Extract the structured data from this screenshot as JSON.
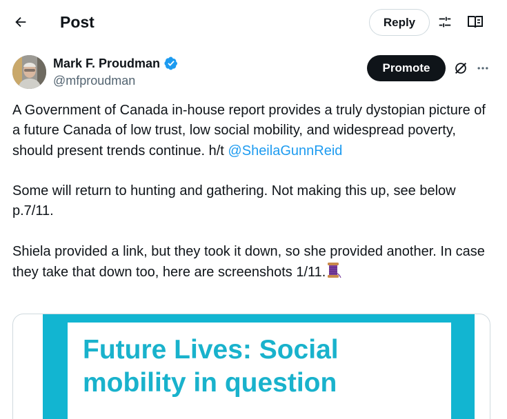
{
  "header": {
    "title": "Post",
    "reply_label": "Reply"
  },
  "author": {
    "name": "Mark F. Proudman",
    "handle": "@mfproudman",
    "promote_label": "Promote"
  },
  "post": {
    "paragraph1_text": "A Government of Canada in-house report provides a truly dystopian picture of a future Canada of low trust, low social mobility, and widespread poverty, should present trends continue.  h/t ",
    "paragraph1_mention": "@SheilaGunnReid",
    "paragraph2": "Some will return to hunting and gathering.  Not making this up, see below p.7/11.",
    "paragraph3": "Shiela provided a link, but they took it down, so she provided another.  In case they take that down too, here are screenshots 1/11."
  },
  "media": {
    "title_line1": "Future Lives: Social",
    "title_line2": "mobility in question"
  },
  "colors": {
    "accent": "#1d9bf0",
    "media_cyan": "#12b5d1",
    "text": "#0f1419",
    "secondary": "#536471"
  },
  "icons": [
    "back-arrow-icon",
    "filter-sliders-icon",
    "reader-book-icon",
    "verified-badge-icon",
    "grok-icon",
    "more-dots-icon",
    "spool-emoji-icon"
  ]
}
